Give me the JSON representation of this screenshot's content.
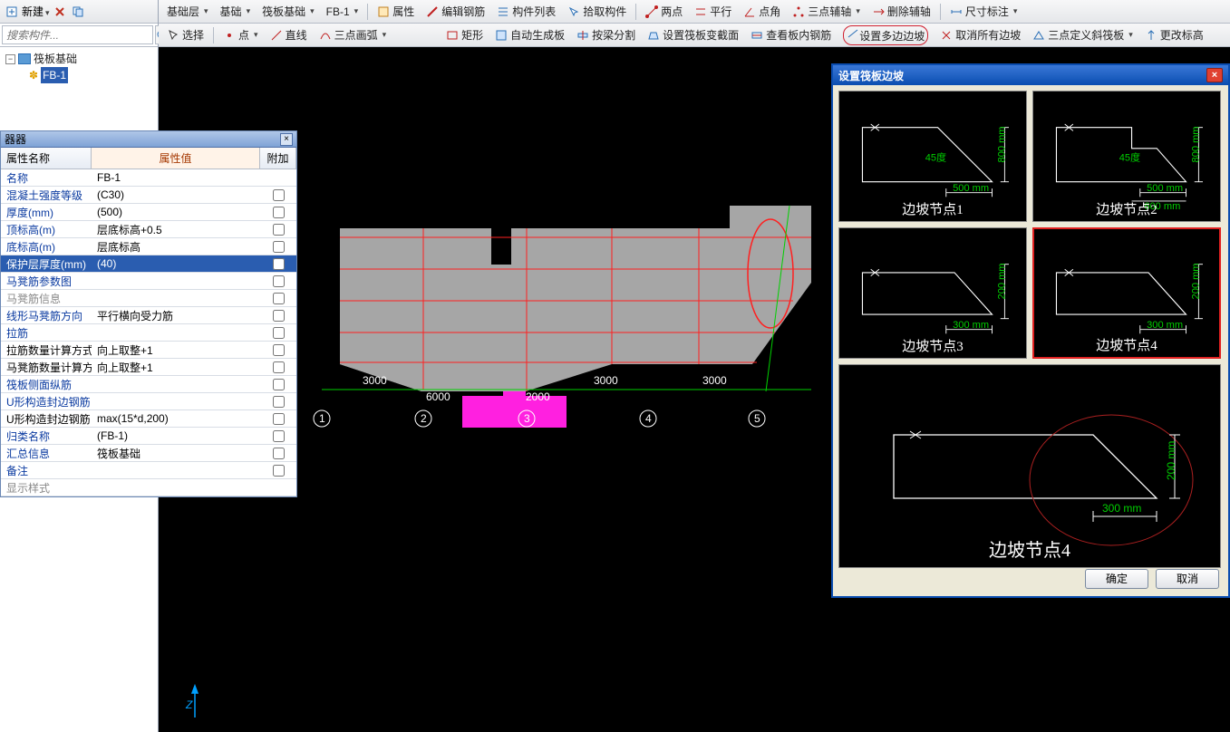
{
  "sidebar": {
    "new_label": "新建",
    "search_placeholder": "搜索构件...",
    "tree_root": "筏板基础",
    "tree_child": "FB-1"
  },
  "toolbar1": {
    "combo1": "基础层",
    "combo2": "基础",
    "combo3": "筏板基础",
    "combo4": "FB-1",
    "attr": "属性",
    "edit_rebar": "编辑钢筋",
    "component_list": "构件列表",
    "pick_component": "拾取构件",
    "two_point": "两点",
    "parallel": "平行",
    "point_angle": "点角",
    "three_point_axis": "三点辅轴",
    "del_axis": "删除辅轴",
    "dim": "尺寸标注"
  },
  "toolbar2": {
    "select": "选择",
    "point": "点",
    "line": "直线",
    "arc3": "三点画弧",
    "rect": "矩形",
    "auto_board": "自动生成板",
    "beam_split": "按梁分割",
    "set_section": "设置筏板变截面",
    "view_rebar": "查看板内钢筋",
    "set_multi_slope": "设置多边边坡",
    "cancel_slope": "取消所有边坡",
    "three_point_slab": "三点定义斜筏板",
    "change_elev": "更改标高"
  },
  "prop": {
    "panel_title": "器器",
    "col_name": "属性名称",
    "col_val": "属性值",
    "col_ext": "附加",
    "rows": [
      {
        "n": "名称",
        "v": "FB-1",
        "blue": true,
        "cb": false
      },
      {
        "n": "混凝土强度等级",
        "v": "(C30)",
        "blue": true,
        "cb": true
      },
      {
        "n": "厚度(mm)",
        "v": "(500)",
        "blue": true,
        "cb": true
      },
      {
        "n": "顶标高(m)",
        "v": "层底标高+0.5",
        "blue": true,
        "cb": true
      },
      {
        "n": "底标高(m)",
        "v": "层底标高",
        "blue": true,
        "cb": true
      },
      {
        "n": "保护层厚度(mm)",
        "v": "(40)",
        "blue": true,
        "cb": true,
        "sel": true
      },
      {
        "n": "马凳筋参数图",
        "v": "",
        "blue": true,
        "cb": true
      },
      {
        "n": "马凳筋信息",
        "v": "",
        "gray": true,
        "cb": true
      },
      {
        "n": "线形马凳筋方向",
        "v": "平行横向受力筋",
        "blue": true,
        "cb": true
      },
      {
        "n": "拉筋",
        "v": "",
        "blue": true,
        "cb": true
      },
      {
        "n": "拉筋数量计算方式",
        "v": "向上取整+1",
        "bk": true,
        "cb": true
      },
      {
        "n": "马凳筋数量计算方",
        "v": "向上取整+1",
        "bk": true,
        "cb": true
      },
      {
        "n": "筏板侧面纵筋",
        "v": "",
        "blue": true,
        "cb": true
      },
      {
        "n": "U形构造封边钢筋",
        "v": "",
        "blue": true,
        "cb": true
      },
      {
        "n": "U形构造封边钢筋",
        "v": "max(15*d,200)",
        "bk": true,
        "cb": true
      },
      {
        "n": "归类名称",
        "v": "(FB-1)",
        "blue": true,
        "cb": true
      },
      {
        "n": "汇总信息",
        "v": "筏板基础",
        "blue": true,
        "cb": true
      },
      {
        "n": "备注",
        "v": "",
        "blue": true,
        "cb": true
      },
      {
        "n": "显示样式",
        "v": "",
        "gray": true,
        "cb": false
      }
    ]
  },
  "canvas": {
    "dims": [
      "3000",
      "6000",
      "2000",
      "3000",
      "3000"
    ],
    "nodes": [
      "1",
      "2",
      "3",
      "4",
      "5"
    ],
    "axis_label": "Z"
  },
  "dialog": {
    "title": "设置筏板边坡",
    "thumbs": [
      {
        "cap": "边坡节点1",
        "d1": "500 mm",
        "d2": "800 mm",
        "d3": "",
        "a": "45度"
      },
      {
        "cap": "边坡节点2",
        "d1": "500 mm",
        "d2": "800 mm",
        "d3": "600 mm",
        "a": "45度"
      },
      {
        "cap": "边坡节点3",
        "d1": "300 mm",
        "d2": "200 mm",
        "d3": "",
        "a": ""
      },
      {
        "cap": "边坡节点4",
        "d1": "300 mm",
        "d2": "200 mm",
        "d3": "",
        "a": ""
      }
    ],
    "preview": {
      "cap": "边坡节点4",
      "d1": "300  mm",
      "d2": "200  mm"
    },
    "ok": "确定",
    "cancel": "取消"
  }
}
